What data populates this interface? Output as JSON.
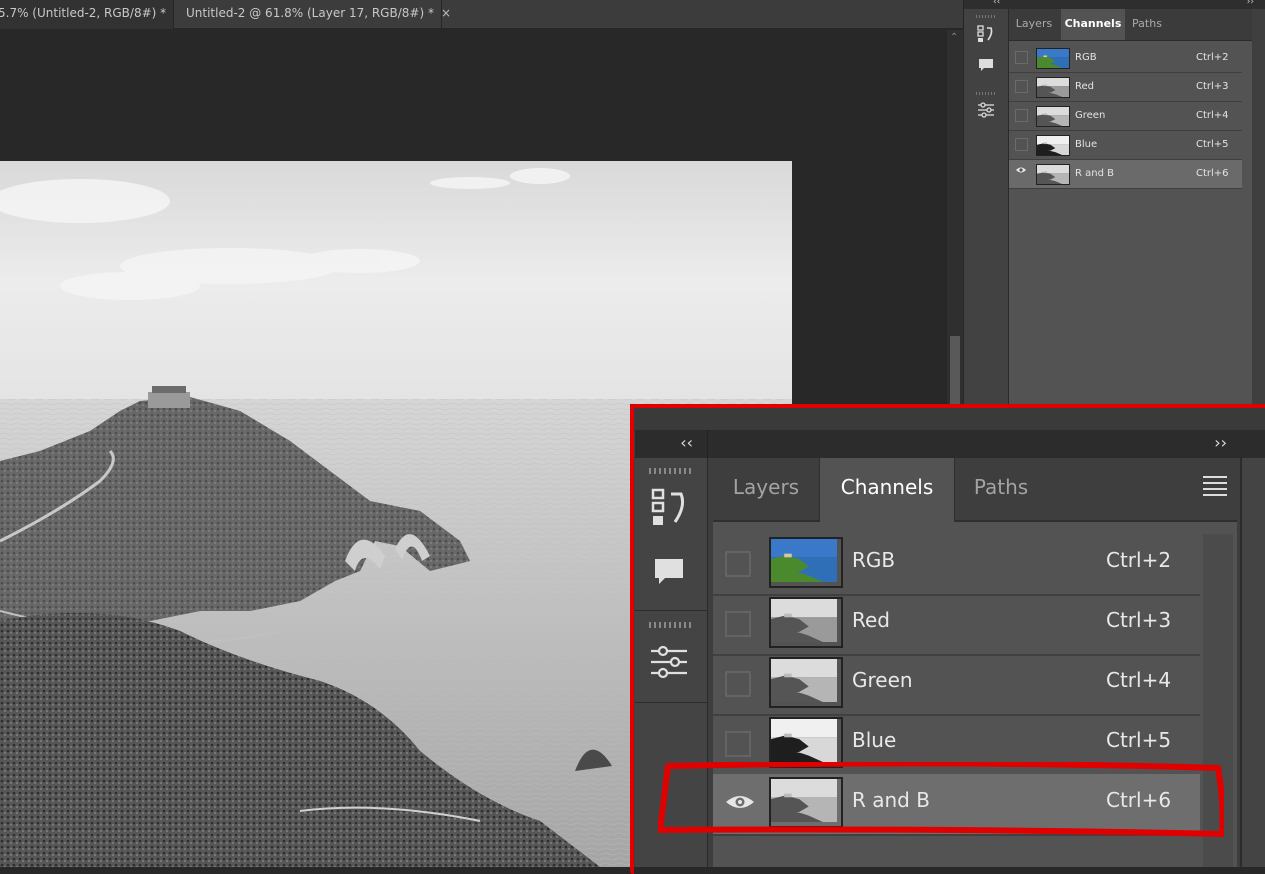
{
  "document_tabs": [
    {
      "label": "5.7% (Untitled-2, RGB/8#) *",
      "close": "×"
    },
    {
      "label": "Untitled-2 @ 61.8% (Layer 17, RGB/8#) *",
      "close": "×"
    }
  ],
  "panel": {
    "tabs": [
      "Layers",
      "Channels",
      "Paths"
    ],
    "active_tab": "Channels",
    "collapse_left_glyph": "‹‹",
    "collapse_right_glyph": "››",
    "channels": [
      {
        "name": "RGB",
        "shortcut": "Ctrl+2",
        "visible": false,
        "selected": false
      },
      {
        "name": "Red",
        "shortcut": "Ctrl+3",
        "visible": false,
        "selected": false
      },
      {
        "name": "Green",
        "shortcut": "Ctrl+4",
        "visible": false,
        "selected": false
      },
      {
        "name": "Blue",
        "shortcut": "Ctrl+5",
        "visible": false,
        "selected": false
      },
      {
        "name": "R and B",
        "shortcut": "Ctrl+6",
        "visible": true,
        "selected": true
      }
    ]
  },
  "icons": {
    "history": "history-icon",
    "comment": "comment-icon",
    "adjust": "sliders-icon",
    "visibility": "eye-icon",
    "menu": "panel-menu-icon"
  },
  "colors": {
    "highlight": "#e10000",
    "panel_bg": "#535353",
    "selected_row": "#6e6e6e"
  }
}
